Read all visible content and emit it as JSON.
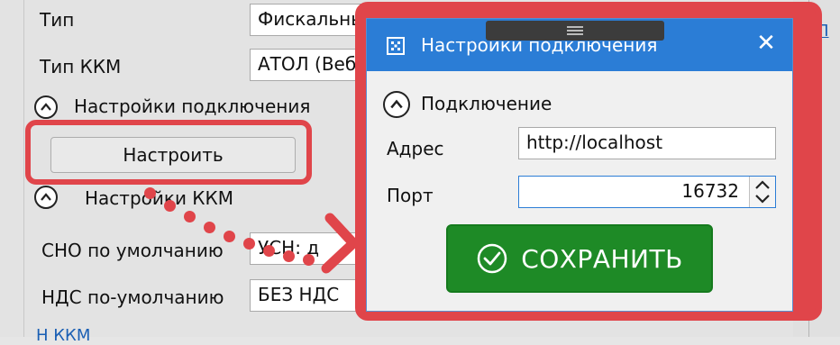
{
  "background": {
    "type_label": "Тип",
    "type_value": "Фискальный регистратор ККМ",
    "kkm_type_label": "Тип ККМ",
    "kkm_type_value": "АТОЛ (Веб-",
    "connection_section": "Настройки подключения",
    "setup_button": "Настроить",
    "kkm_section": "Настройки ККМ",
    "sno_label": "СНО по умолчанию",
    "sno_value": "УСН: д",
    "nds_label": "НДС по-умолчанию",
    "nds_value": "БЕЗ НДС",
    "right_link": "П",
    "bottom_link": "Н                            ККМ"
  },
  "dialog": {
    "title": "Настройки подключения",
    "section": "Подключение",
    "address_label": "Адрес",
    "address_value": "http://localhost",
    "port_label": "Порт",
    "port_value": "16732",
    "save_button": "СОХРАНИТЬ"
  },
  "colors": {
    "highlight": "#e0454a",
    "titlebar": "#2b7dd6",
    "save": "#1e8a26"
  }
}
